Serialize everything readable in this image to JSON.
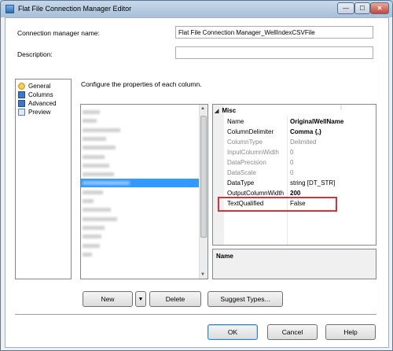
{
  "window": {
    "title": "Flat File Connection Manager Editor",
    "minimize_label": "—",
    "maximize_label": "☐",
    "close_label": "✕"
  },
  "form": {
    "name_label": "Connection manager name:",
    "name_value": "Flat File Connection Manager_WellIndexCSVFile",
    "description_label": "Description:",
    "description_value": "",
    "instructions": "Configure the properties of each column."
  },
  "nav": {
    "items": [
      {
        "label": "General",
        "icon": "general-icon"
      },
      {
        "label": "Columns",
        "icon": "columns-icon"
      },
      {
        "label": "Advanced",
        "icon": "advanced-icon"
      },
      {
        "label": "Preview",
        "icon": "preview-icon"
      }
    ]
  },
  "columns_list": {
    "selected_index": 8,
    "rows": 17
  },
  "grid": {
    "category": "Misc",
    "properties": [
      {
        "name": "Name",
        "value": "OriginalWellName",
        "bold": true,
        "disabled": false
      },
      {
        "name": "ColumnDelimiter",
        "value": "Comma {,}",
        "bold": true,
        "disabled": false
      },
      {
        "name": "ColumnType",
        "value": "Delimited",
        "bold": false,
        "disabled": true
      },
      {
        "name": "InputColumnWidth",
        "value": "0",
        "bold": false,
        "disabled": true
      },
      {
        "name": "DataPrecision",
        "value": "0",
        "bold": false,
        "disabled": true
      },
      {
        "name": "DataScale",
        "value": "0",
        "bold": false,
        "disabled": true
      },
      {
        "name": "DataType",
        "value": "string [DT_STR]",
        "bold": false,
        "disabled": false
      },
      {
        "name": "OutputColumnWidth",
        "value": "200",
        "bold": true,
        "disabled": false
      },
      {
        "name": "TextQualified",
        "value": "False",
        "bold": false,
        "disabled": false
      }
    ]
  },
  "description_panel": {
    "title": "Name"
  },
  "buttons": {
    "new": "New",
    "delete": "Delete",
    "suggest": "Suggest Types...",
    "ok": "OK",
    "cancel": "Cancel",
    "help": "Help"
  },
  "colors": {
    "highlight": "#d9303a",
    "selection": "#3399ff"
  }
}
